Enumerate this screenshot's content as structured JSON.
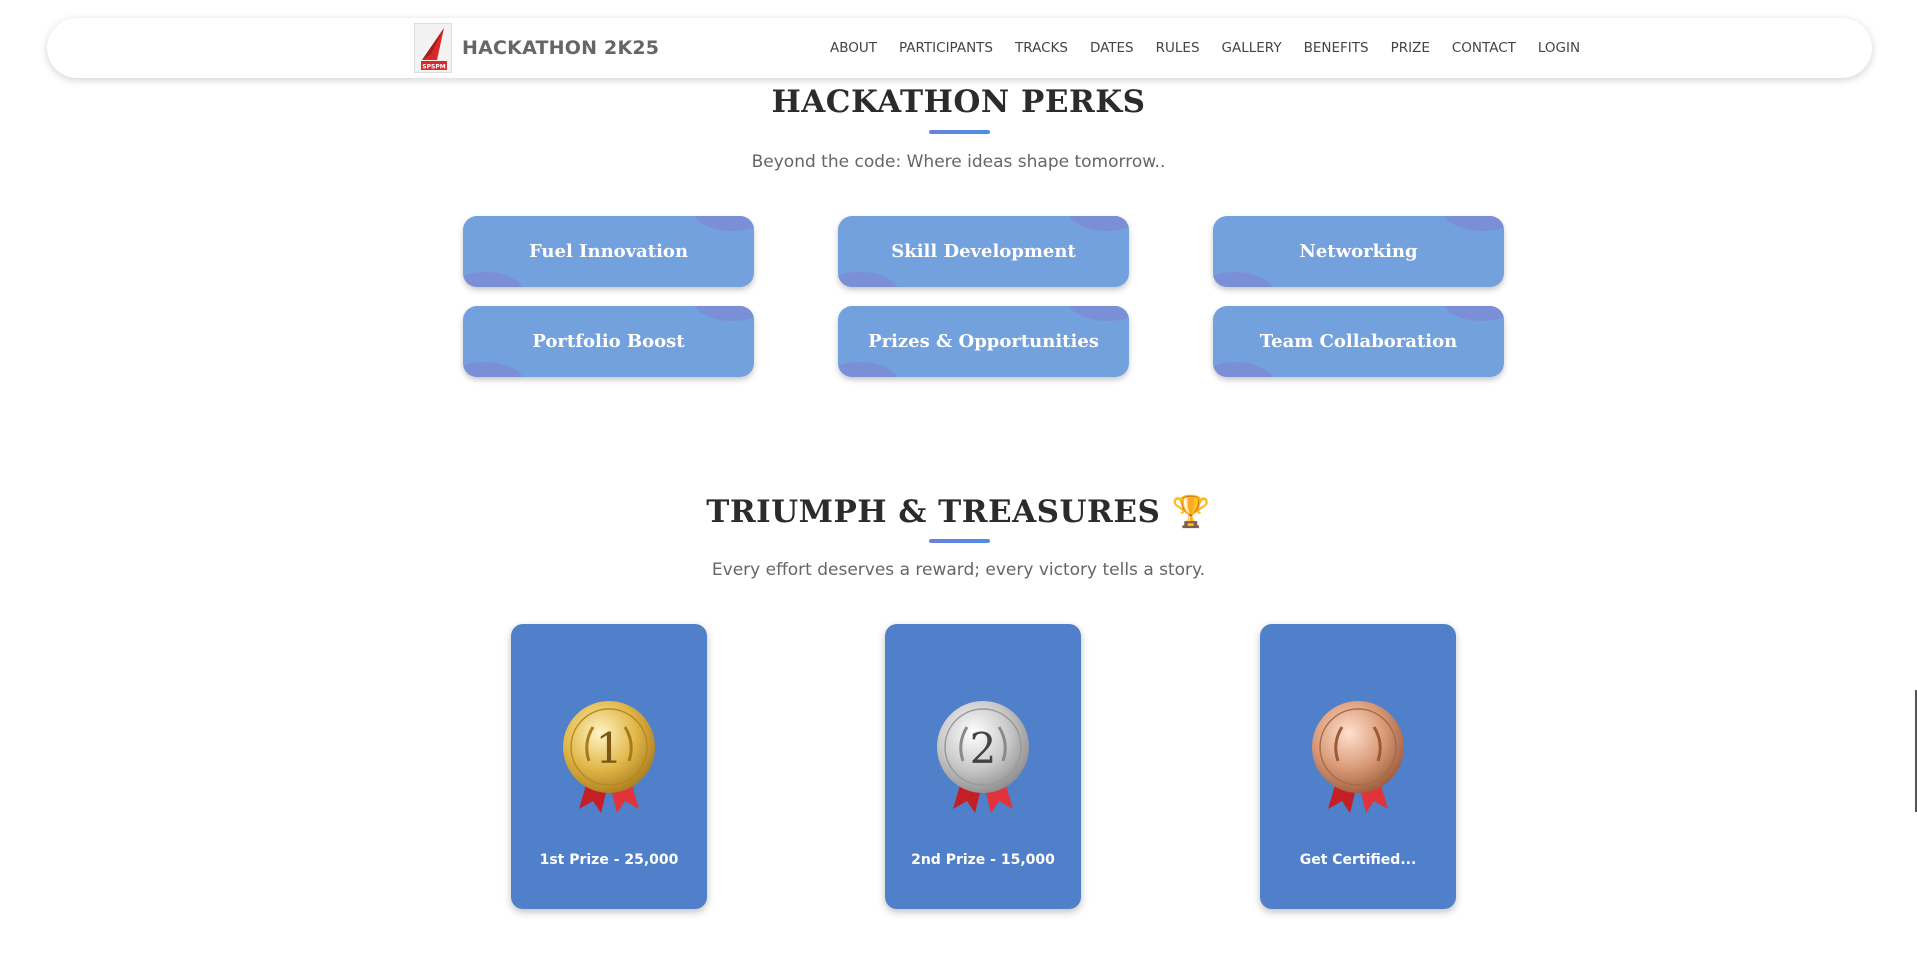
{
  "nav": {
    "brand": "HACKATHON 2K25",
    "logo_text": "SPSPM",
    "links": [
      "ABOUT",
      "PARTICIPANTS",
      "TRACKS",
      "DATES",
      "RULES",
      "GALLERY",
      "BENEFITS",
      "PRIZE",
      "CONTACT",
      "LOGIN"
    ]
  },
  "perks": {
    "title": "HACKATHON PERKS",
    "subtitle": "Beyond the code: Where ideas shape tomorrow..",
    "items": [
      "Fuel Innovation",
      "Skill Development",
      "Networking",
      "Portfolio Boost",
      "Prizes & Opportunities",
      "Team Collaboration"
    ]
  },
  "prizes": {
    "title": "TRIUMPH & TREASURES 🏆",
    "subtitle": "Every effort deserves a reward; every victory tells a story.",
    "items": [
      {
        "label": "1st Prize - 25,000",
        "medal": "gold-medal-icon",
        "number": "1"
      },
      {
        "label": "2nd Prize - 15,000",
        "medal": "silver-medal-icon",
        "number": "2"
      },
      {
        "label": "Get Certified...",
        "medal": "bronze-medal-icon",
        "number": ""
      }
    ]
  },
  "colors": {
    "perk_card": "#72a1de",
    "prize_card": "#4f80c9",
    "accent_bar": "#5b87e6",
    "gold": "#e2b84a",
    "silver": "#c9c9c9",
    "bronze": "#d99a78",
    "ribbon": "#d4232b"
  }
}
